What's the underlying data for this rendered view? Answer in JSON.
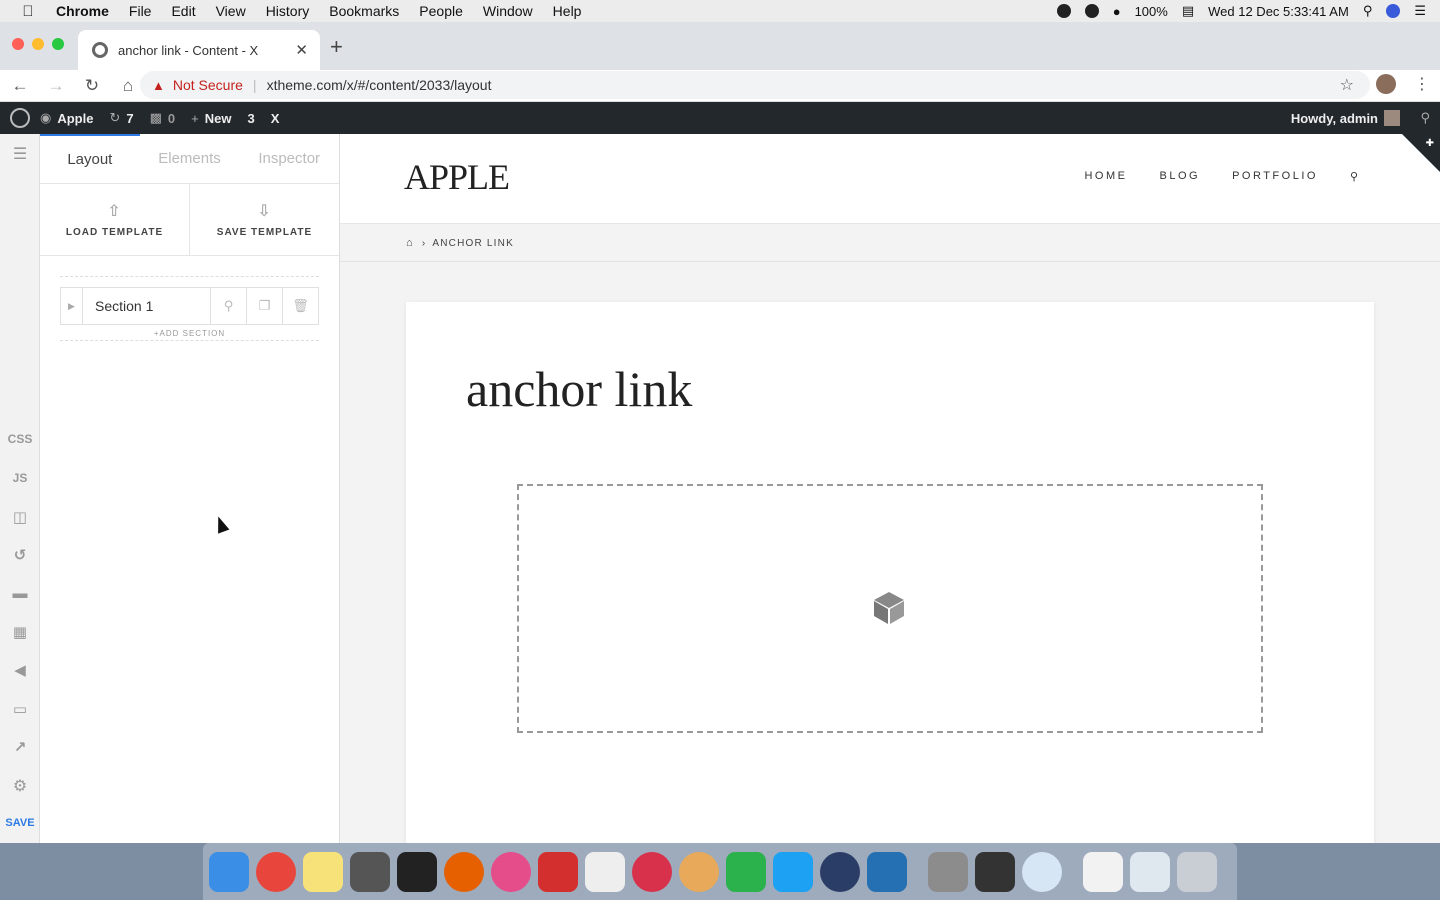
{
  "menubar": {
    "app": "Chrome",
    "items": [
      "File",
      "Edit",
      "View",
      "History",
      "Bookmarks",
      "People",
      "Window",
      "Help"
    ],
    "battery": "100%",
    "datetime": "Wed 12 Dec  5:33:41 AM"
  },
  "browser": {
    "tab_title": "anchor link - Content - X",
    "not_secure": "Not Secure",
    "url": "xtheme.com/x/#/content/2033/layout"
  },
  "adminbar": {
    "site": "Apple",
    "updates": "7",
    "comments": "0",
    "new": "New",
    "theme_num": "3",
    "theme_x": "X",
    "howdy": "Howdy, admin"
  },
  "rail": {
    "css": "CSS",
    "js": "JS",
    "save": "SAVE"
  },
  "panel": {
    "tabs": [
      "Layout",
      "Elements",
      "Inspector"
    ],
    "load_template": "LOAD TEMPLATE",
    "save_template": "SAVE TEMPLATE",
    "section_name": "Section 1",
    "add_section": "+ADD SECTION"
  },
  "site": {
    "logo": "APPLE",
    "nav": [
      "HOME",
      "BLOG",
      "PORTFOLIO"
    ],
    "breadcrumb": "ANCHOR LINK",
    "page_title": "anchor link"
  },
  "colors": {
    "accent": "#2c7be5",
    "adminbar": "#23282d",
    "warning": "#c5221f"
  }
}
